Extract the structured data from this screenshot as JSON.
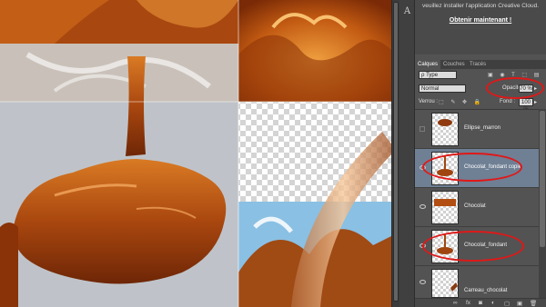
{
  "cloud_message": {
    "text": "veuillez installer l'application Creative Cloud.",
    "link": "Obtenir maintenant !"
  },
  "tool_icon": "A",
  "tabs": [
    {
      "label": "Calques",
      "active": true
    },
    {
      "label": "Couches",
      "active": false
    },
    {
      "label": "Tracés",
      "active": false
    }
  ],
  "filter": {
    "type_label": "ρ Type",
    "icons": "▣ ◉ T ⬚ ▤"
  },
  "blend": {
    "mode": "Normal",
    "opacity_label": "Opacité :",
    "opacity_value": "70 %",
    "caret": "▸"
  },
  "lock": {
    "label": "Verrou :",
    "icons": "⬚ ✎ ✥ 🔒",
    "fill_label": "Fond :",
    "fill_value": "100 %",
    "caret": "▸"
  },
  "layers": [
    {
      "name": "Ellipse_marron",
      "visible": false,
      "selected": false
    },
    {
      "name": "Chocolat_fondant copie",
      "visible": true,
      "selected": true
    },
    {
      "name": "Chocolat",
      "visible": true,
      "selected": false
    },
    {
      "name": "Chocolat_fondant",
      "visible": true,
      "selected": false
    },
    {
      "name": "Carreau_chocolat",
      "visible": true,
      "selected": false
    }
  ],
  "footer_icons": [
    "∞",
    "fx",
    "◙",
    "◐",
    "▢",
    "▣",
    "🗑"
  ],
  "colors": {
    "annotation_red": "#e01818",
    "selected_row": "#6f7f94",
    "chocolate": "#a0440e",
    "caramel": "#d06a18"
  }
}
